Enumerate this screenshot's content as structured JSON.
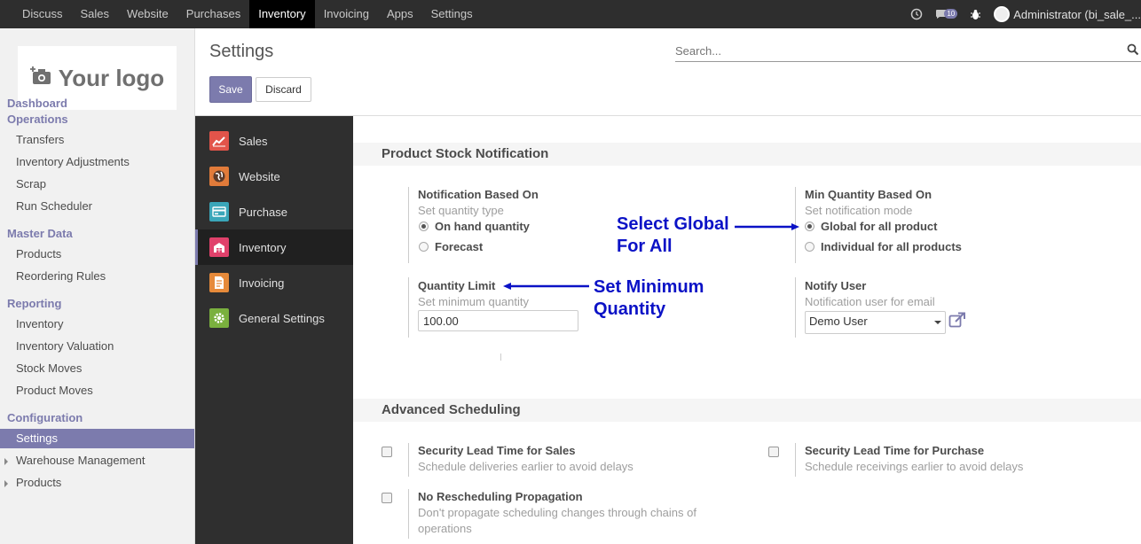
{
  "topbar": {
    "menu": [
      "Discuss",
      "Sales",
      "Website",
      "Purchases",
      "Inventory",
      "Invoicing",
      "Apps",
      "Settings"
    ],
    "active": "Inventory",
    "messages_count": "10",
    "user": "Administrator (bi_sale_..."
  },
  "sidebar": {
    "logo_text": "Your logo",
    "dashboard": "Dashboard",
    "operations": "Operations",
    "operations_items": [
      "Transfers",
      "Inventory Adjustments",
      "Scrap",
      "Run Scheduler"
    ],
    "master_data": "Master Data",
    "master_items": [
      "Products",
      "Reordering Rules"
    ],
    "reporting": "Reporting",
    "reporting_items": [
      "Inventory",
      "Inventory Valuation",
      "Stock Moves",
      "Product Moves"
    ],
    "configuration": "Configuration",
    "config_items": [
      "Settings",
      "Warehouse Management",
      "Products"
    ]
  },
  "control_panel": {
    "title": "Settings",
    "search_placeholder": "Search...",
    "save_label": "Save",
    "discard_label": "Discard"
  },
  "apps": [
    "Sales",
    "Website",
    "Purchase",
    "Inventory",
    "Invoicing",
    "General Settings"
  ],
  "colors": {
    "accent": "#7c7bad",
    "annotation": "#0b12c6"
  },
  "stock_notification": {
    "title": "Product Stock Notification",
    "based_on_label": "Notification Based On",
    "based_on_hint": "Set quantity type",
    "opt_on_hand": "On hand quantity",
    "opt_forecast": "Forecast",
    "min_qty_label": "Min Quantity Based On",
    "min_qty_hint": "Set notification mode",
    "opt_global": "Global for all product",
    "opt_individual": "Individual for all products",
    "qty_limit_label": "Quantity Limit",
    "qty_limit_hint": "Set minimum quantity",
    "qty_limit_value": "100.00",
    "notify_label": "Notify User",
    "notify_hint": "Notification user for email",
    "notify_value": "Demo User"
  },
  "annotations": {
    "select_global_1": "Select Global",
    "select_global_2": "For All",
    "set_min_1": "Set Minimum",
    "set_min_2": "Quantity"
  },
  "advanced": {
    "title": "Advanced Scheduling",
    "sales_lead_label": "Security Lead Time for Sales",
    "sales_lead_hint": "Schedule deliveries earlier to avoid delays",
    "purchase_lead_label": "Security Lead Time for Purchase",
    "purchase_lead_hint": "Schedule receivings earlier to avoid delays",
    "no_resched_label": "No Rescheduling Propagation",
    "no_resched_hint_1": "Don't propagate scheduling changes through chains of",
    "no_resched_hint_2": "operations"
  }
}
